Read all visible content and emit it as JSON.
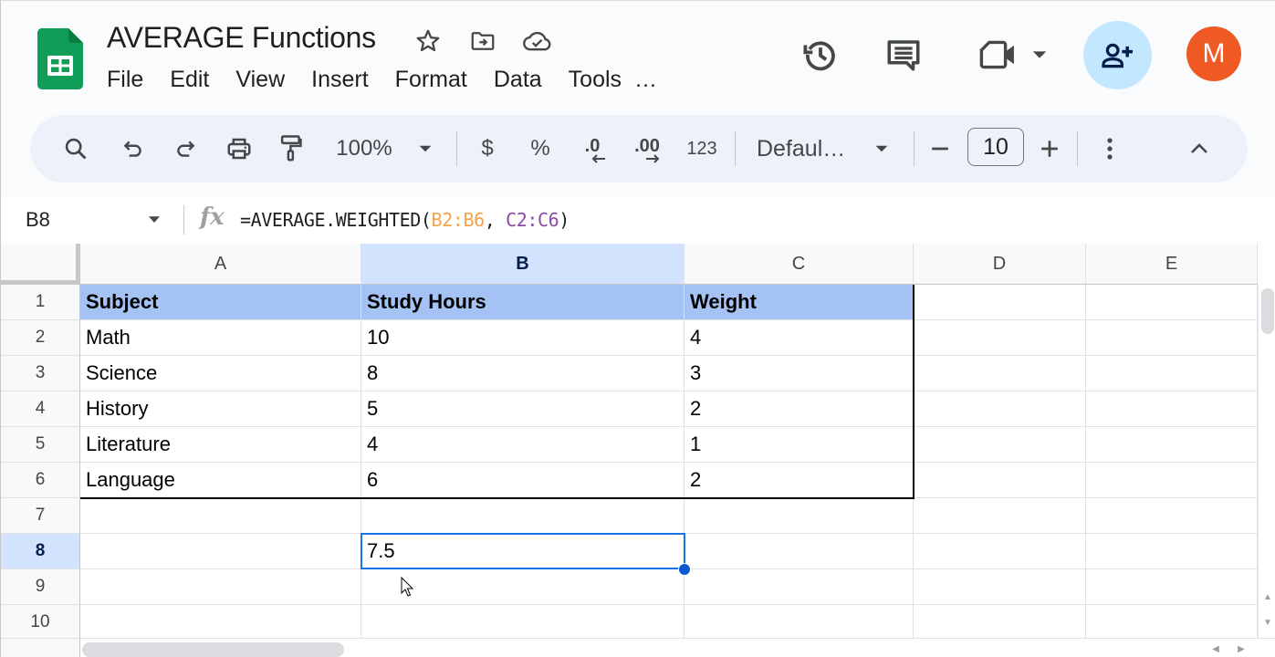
{
  "doc": {
    "title": "AVERAGE Functions",
    "menu": [
      "File",
      "Edit",
      "View",
      "Insert",
      "Format",
      "Data",
      "Tools",
      "…"
    ],
    "avatar_initial": "M"
  },
  "header_icons": [
    "star-icon",
    "move-to-folder-icon",
    "cloud-saved-icon",
    "version-history-icon",
    "comments-icon",
    "meet-icon",
    "share-icon"
  ],
  "toolbar": {
    "zoom": "100%",
    "currency": "$",
    "percent": "%",
    "decrease_decimal": ".0",
    "increase_decimal": ".00",
    "number_format": "123",
    "font": "Defaul…",
    "font_size": "10"
  },
  "formula_bar": {
    "name_box": "B8",
    "fx": "fx",
    "formula_prefix": "=AVERAGE.WEIGHTED(",
    "ref1": "B2:B6",
    "sep": ", ",
    "ref2": "C2:C6",
    "formula_suffix": ")"
  },
  "sheet": {
    "columns": [
      "A",
      "B",
      "C",
      "D",
      "E"
    ],
    "selected_column": "B",
    "rows": [
      "1",
      "2",
      "3",
      "4",
      "5",
      "6",
      "7",
      "8",
      "9",
      "10"
    ],
    "selected_row": "8",
    "selected_cell": "B8",
    "cells": [
      [
        "Subject",
        "Study Hours",
        "Weight",
        "",
        ""
      ],
      [
        "Math",
        "10",
        "4",
        "",
        ""
      ],
      [
        "Science",
        "8",
        "3",
        "",
        ""
      ],
      [
        "History",
        "5",
        "2",
        "",
        ""
      ],
      [
        "Literature",
        "4",
        "1",
        "",
        ""
      ],
      [
        "Language",
        "6",
        "2",
        "",
        ""
      ],
      [
        "",
        "",
        "",
        "",
        ""
      ],
      [
        "",
        "7.5",
        "",
        "",
        ""
      ],
      [
        "",
        "",
        "",
        "",
        ""
      ],
      [
        "",
        "",
        "",
        "",
        ""
      ]
    ],
    "header_fill": "#a4c2f4",
    "selection_color": "#1a73e8"
  }
}
